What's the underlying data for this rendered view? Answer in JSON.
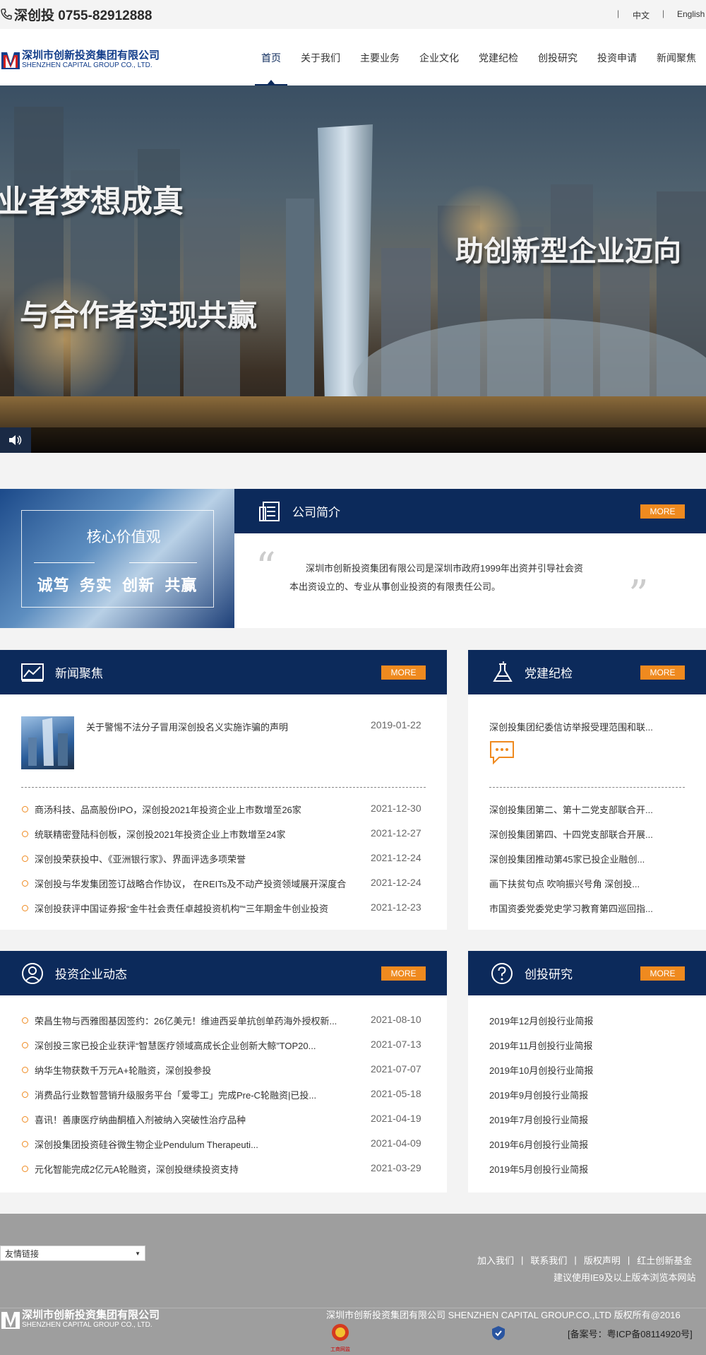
{
  "topbar": {
    "phone": "深创投 0755-82912888",
    "lang_cn": "中文",
    "lang_en": "English",
    "sep": "|"
  },
  "logo": {
    "cn": "深圳市创新投资集团有限公司",
    "en": "SHENZHEN CAPITAL GROUP CO., LTD."
  },
  "nav": [
    "首页",
    "关于我们",
    "主要业务",
    "企业文化",
    "党建纪检",
    "创投研究",
    "投资申请",
    "新闻聚焦"
  ],
  "banner": {
    "line1": "业者梦想成真",
    "line2": "助创新型企业迈向",
    "line3": "与合作者实现共赢"
  },
  "values": {
    "title": "核心价值观",
    "words": "诚笃  务实  创新  共赢"
  },
  "intro": {
    "title": "公司简介",
    "more": "MORE",
    "text1": "深圳市创新投资集团有限公司是深圳市政府1999年出资并引导社会资",
    "text2": "本出资设立的、专业从事创业投资的有限责任公司。"
  },
  "news": {
    "title": "新闻聚焦",
    "more": "MORE",
    "featured": {
      "title": "关于警惕不法分子冒用深创投名义实施诈骗的声明",
      "date": "2019-01-22"
    },
    "items": [
      {
        "title": "商汤科技、品高股份IPO，深创投2021年投资企业上市数增至26家",
        "date": "2021-12-30"
      },
      {
        "title": "统联精密登陆科创板，深创投2021年投资企业上市数增至24家",
        "date": "2021-12-27"
      },
      {
        "title": "深创投荣获投中、《亚洲银行家》、界面评选多项荣誉",
        "date": "2021-12-24"
      },
      {
        "title": "深创投与华发集团签订战略合作协议， 在REITs及不动产投资领域展开深度合",
        "date": "2021-12-24"
      },
      {
        "title": "深创投获评中国证券报“金牛社会责任卓越投资机构”“三年期金牛创业投资",
        "date": "2021-12-23"
      }
    ]
  },
  "party": {
    "title": "党建纪检",
    "more": "MORE",
    "featured": "深创投集团纪委信访举报受理范围和联...",
    "items": [
      "深创投集团第二、第十二党支部联合开...",
      "深创投集团第四、十四党支部联合开展...",
      "深创投集团推动第45家已投企业融创...",
      "画下扶贫句点 吹响振兴号角 深创投...",
      "市国资委党委党史学习教育第四巡回指..."
    ]
  },
  "invest": {
    "title": "投资企业动态",
    "more": "MORE",
    "items": [
      {
        "title": "荣昌生物与西雅图基因签约：26亿美元！维迪西妥单抗创单药海外授权新...",
        "date": "2021-08-10"
      },
      {
        "title": "深创投三家已投企业获评“智慧医疗领域高成长企业创新大鲸”TOP20...",
        "date": "2021-07-13"
      },
      {
        "title": "纳华生物获数千万元A+轮融资，深创投参投",
        "date": "2021-07-07"
      },
      {
        "title": "消费品行业数智营销升级服务平台「爱零工」完成Pre-C轮融资|已投...",
        "date": "2021-05-18"
      },
      {
        "title": "喜讯！善康医疗纳曲酮植入剂被纳入突破性治疗品种",
        "date": "2021-04-19"
      },
      {
        "title": "深创投集团投资硅谷微生物企业Pendulum Therapeuti...",
        "date": "2021-04-09"
      },
      {
        "title": "元化智能完成2亿元A轮融资，深创投继续投资支持",
        "date": "2021-03-29"
      }
    ]
  },
  "research": {
    "title": "创投研究",
    "more": "MORE",
    "items": [
      "2019年12月创投行业简报",
      "2019年11月创投行业简报",
      "2019年10月创投行业简报",
      "2019年9月创投行业简报",
      "2019年7月创投行业简报",
      "2019年6月创投行业简报",
      "2019年5月创投行业简报"
    ]
  },
  "footer": {
    "select": "友情链接",
    "links": [
      "加入我们",
      "联系我们",
      "版权声明",
      "红土创新基金"
    ],
    "browser_note": "建议使用IE9及以上版本浏览本网站",
    "copyright": "深圳市创新投资集团有限公司 SHENZHEN CAPITAL GROUP.CO.,LTD 版权所有@2016",
    "icp": "[备案号：粤ICP备08114920号]",
    "badge": "工商网监"
  },
  "colors": {
    "navy": "#0c2a5b",
    "orange": "#ef8a1f"
  }
}
